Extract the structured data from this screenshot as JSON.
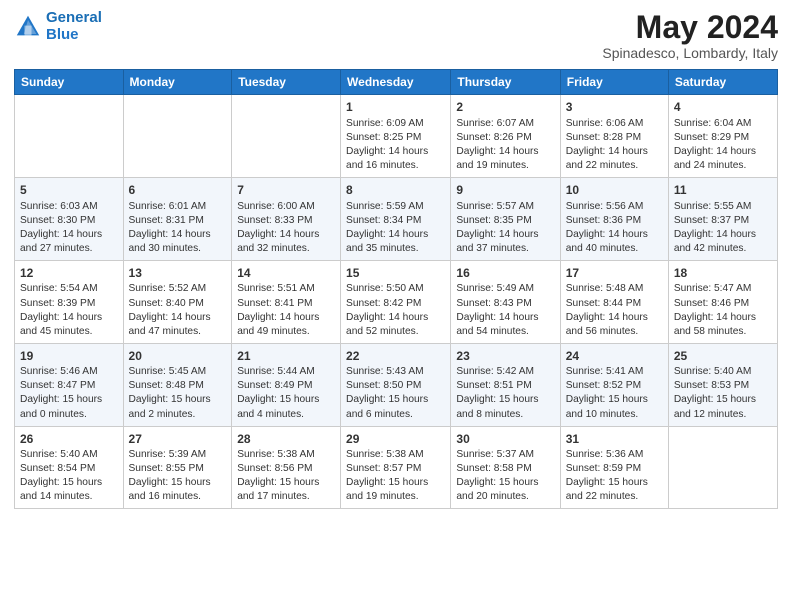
{
  "header": {
    "logo_line1": "General",
    "logo_line2": "Blue",
    "month_title": "May 2024",
    "subtitle": "Spinadesco, Lombardy, Italy"
  },
  "days_of_week": [
    "Sunday",
    "Monday",
    "Tuesday",
    "Wednesday",
    "Thursday",
    "Friday",
    "Saturday"
  ],
  "weeks": [
    [
      {
        "day": "",
        "sunrise": "",
        "sunset": "",
        "daylight": ""
      },
      {
        "day": "",
        "sunrise": "",
        "sunset": "",
        "daylight": ""
      },
      {
        "day": "",
        "sunrise": "",
        "sunset": "",
        "daylight": ""
      },
      {
        "day": "1",
        "sunrise": "Sunrise: 6:09 AM",
        "sunset": "Sunset: 8:25 PM",
        "daylight": "Daylight: 14 hours and 16 minutes."
      },
      {
        "day": "2",
        "sunrise": "Sunrise: 6:07 AM",
        "sunset": "Sunset: 8:26 PM",
        "daylight": "Daylight: 14 hours and 19 minutes."
      },
      {
        "day": "3",
        "sunrise": "Sunrise: 6:06 AM",
        "sunset": "Sunset: 8:28 PM",
        "daylight": "Daylight: 14 hours and 22 minutes."
      },
      {
        "day": "4",
        "sunrise": "Sunrise: 6:04 AM",
        "sunset": "Sunset: 8:29 PM",
        "daylight": "Daylight: 14 hours and 24 minutes."
      }
    ],
    [
      {
        "day": "5",
        "sunrise": "Sunrise: 6:03 AM",
        "sunset": "Sunset: 8:30 PM",
        "daylight": "Daylight: 14 hours and 27 minutes."
      },
      {
        "day": "6",
        "sunrise": "Sunrise: 6:01 AM",
        "sunset": "Sunset: 8:31 PM",
        "daylight": "Daylight: 14 hours and 30 minutes."
      },
      {
        "day": "7",
        "sunrise": "Sunrise: 6:00 AM",
        "sunset": "Sunset: 8:33 PM",
        "daylight": "Daylight: 14 hours and 32 minutes."
      },
      {
        "day": "8",
        "sunrise": "Sunrise: 5:59 AM",
        "sunset": "Sunset: 8:34 PM",
        "daylight": "Daylight: 14 hours and 35 minutes."
      },
      {
        "day": "9",
        "sunrise": "Sunrise: 5:57 AM",
        "sunset": "Sunset: 8:35 PM",
        "daylight": "Daylight: 14 hours and 37 minutes."
      },
      {
        "day": "10",
        "sunrise": "Sunrise: 5:56 AM",
        "sunset": "Sunset: 8:36 PM",
        "daylight": "Daylight: 14 hours and 40 minutes."
      },
      {
        "day": "11",
        "sunrise": "Sunrise: 5:55 AM",
        "sunset": "Sunset: 8:37 PM",
        "daylight": "Daylight: 14 hours and 42 minutes."
      }
    ],
    [
      {
        "day": "12",
        "sunrise": "Sunrise: 5:54 AM",
        "sunset": "Sunset: 8:39 PM",
        "daylight": "Daylight: 14 hours and 45 minutes."
      },
      {
        "day": "13",
        "sunrise": "Sunrise: 5:52 AM",
        "sunset": "Sunset: 8:40 PM",
        "daylight": "Daylight: 14 hours and 47 minutes."
      },
      {
        "day": "14",
        "sunrise": "Sunrise: 5:51 AM",
        "sunset": "Sunset: 8:41 PM",
        "daylight": "Daylight: 14 hours and 49 minutes."
      },
      {
        "day": "15",
        "sunrise": "Sunrise: 5:50 AM",
        "sunset": "Sunset: 8:42 PM",
        "daylight": "Daylight: 14 hours and 52 minutes."
      },
      {
        "day": "16",
        "sunrise": "Sunrise: 5:49 AM",
        "sunset": "Sunset: 8:43 PM",
        "daylight": "Daylight: 14 hours and 54 minutes."
      },
      {
        "day": "17",
        "sunrise": "Sunrise: 5:48 AM",
        "sunset": "Sunset: 8:44 PM",
        "daylight": "Daylight: 14 hours and 56 minutes."
      },
      {
        "day": "18",
        "sunrise": "Sunrise: 5:47 AM",
        "sunset": "Sunset: 8:46 PM",
        "daylight": "Daylight: 14 hours and 58 minutes."
      }
    ],
    [
      {
        "day": "19",
        "sunrise": "Sunrise: 5:46 AM",
        "sunset": "Sunset: 8:47 PM",
        "daylight": "Daylight: 15 hours and 0 minutes."
      },
      {
        "day": "20",
        "sunrise": "Sunrise: 5:45 AM",
        "sunset": "Sunset: 8:48 PM",
        "daylight": "Daylight: 15 hours and 2 minutes."
      },
      {
        "day": "21",
        "sunrise": "Sunrise: 5:44 AM",
        "sunset": "Sunset: 8:49 PM",
        "daylight": "Daylight: 15 hours and 4 minutes."
      },
      {
        "day": "22",
        "sunrise": "Sunrise: 5:43 AM",
        "sunset": "Sunset: 8:50 PM",
        "daylight": "Daylight: 15 hours and 6 minutes."
      },
      {
        "day": "23",
        "sunrise": "Sunrise: 5:42 AM",
        "sunset": "Sunset: 8:51 PM",
        "daylight": "Daylight: 15 hours and 8 minutes."
      },
      {
        "day": "24",
        "sunrise": "Sunrise: 5:41 AM",
        "sunset": "Sunset: 8:52 PM",
        "daylight": "Daylight: 15 hours and 10 minutes."
      },
      {
        "day": "25",
        "sunrise": "Sunrise: 5:40 AM",
        "sunset": "Sunset: 8:53 PM",
        "daylight": "Daylight: 15 hours and 12 minutes."
      }
    ],
    [
      {
        "day": "26",
        "sunrise": "Sunrise: 5:40 AM",
        "sunset": "Sunset: 8:54 PM",
        "daylight": "Daylight: 15 hours and 14 minutes."
      },
      {
        "day": "27",
        "sunrise": "Sunrise: 5:39 AM",
        "sunset": "Sunset: 8:55 PM",
        "daylight": "Daylight: 15 hours and 16 minutes."
      },
      {
        "day": "28",
        "sunrise": "Sunrise: 5:38 AM",
        "sunset": "Sunset: 8:56 PM",
        "daylight": "Daylight: 15 hours and 17 minutes."
      },
      {
        "day": "29",
        "sunrise": "Sunrise: 5:38 AM",
        "sunset": "Sunset: 8:57 PM",
        "daylight": "Daylight: 15 hours and 19 minutes."
      },
      {
        "day": "30",
        "sunrise": "Sunrise: 5:37 AM",
        "sunset": "Sunset: 8:58 PM",
        "daylight": "Daylight: 15 hours and 20 minutes."
      },
      {
        "day": "31",
        "sunrise": "Sunrise: 5:36 AM",
        "sunset": "Sunset: 8:59 PM",
        "daylight": "Daylight: 15 hours and 22 minutes."
      },
      {
        "day": "",
        "sunrise": "",
        "sunset": "",
        "daylight": ""
      }
    ]
  ]
}
